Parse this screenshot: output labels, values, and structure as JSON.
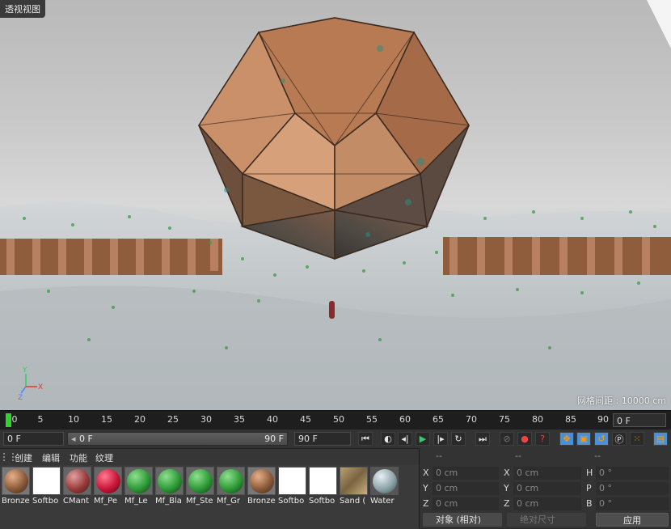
{
  "viewport": {
    "label": "透视视图",
    "grid_info": "网格间距 : 10000 cm",
    "axis": {
      "x": "X",
      "y": "Y",
      "z": "Z"
    }
  },
  "timeline": {
    "ticks": [
      "0",
      "5",
      "10",
      "15",
      "20",
      "25",
      "30",
      "35",
      "40",
      "45",
      "50",
      "55",
      "60",
      "65",
      "70",
      "75",
      "80",
      "85",
      "90"
    ],
    "end_frame": "0 F"
  },
  "controls": {
    "current_frame": "0 F",
    "range_start": "0 F",
    "range_end": "90 F",
    "max_frame": "90 F",
    "buttons": [
      "goto-start",
      "play-reverse",
      "step-back",
      "play",
      "step-forward",
      "loop",
      "goto-end"
    ]
  },
  "materials": {
    "menu": [
      "创建",
      "编辑",
      "功能",
      "纹理"
    ],
    "items": [
      {
        "name": "Bronze",
        "color": "#8a5a38"
      },
      {
        "name": "Softbo",
        "color": "#ffffff"
      },
      {
        "name": "CMant",
        "color": "#9a3a3a"
      },
      {
        "name": "Mf_Pe",
        "color": "#c81538"
      },
      {
        "name": "Mf_Le",
        "color": "#2e9a36"
      },
      {
        "name": "Mf_Bla",
        "color": "#2e9a36"
      },
      {
        "name": "Mf_Ste",
        "color": "#2e9a36"
      },
      {
        "name": "Mf_Gr",
        "color": "#2e9a36"
      },
      {
        "name": "Bronze",
        "color": "#8a5a38"
      },
      {
        "name": "Softbo",
        "color": "#ffffff"
      },
      {
        "name": "Softbo",
        "color": "#ffffff"
      },
      {
        "name": "Sand (",
        "color": "#9c8458"
      },
      {
        "name": "Water",
        "color": "#8ea4aa"
      }
    ]
  },
  "coords": {
    "headers": [
      "--",
      "--",
      "--"
    ],
    "rows": [
      [
        {
          "l": "X",
          "v": "0 cm"
        },
        {
          "l": "X",
          "v": "0 cm"
        },
        {
          "l": "H",
          "v": "0 °"
        }
      ],
      [
        {
          "l": "Y",
          "v": "0 cm"
        },
        {
          "l": "Y",
          "v": "0 cm"
        },
        {
          "l": "P",
          "v": "0 °"
        }
      ],
      [
        {
          "l": "Z",
          "v": "0 cm"
        },
        {
          "l": "Z",
          "v": "0 cm"
        },
        {
          "l": "B",
          "v": "0 °"
        }
      ]
    ],
    "mode": "对象 (相对)",
    "size_mode": "绝对尺寸",
    "apply": "应用"
  }
}
